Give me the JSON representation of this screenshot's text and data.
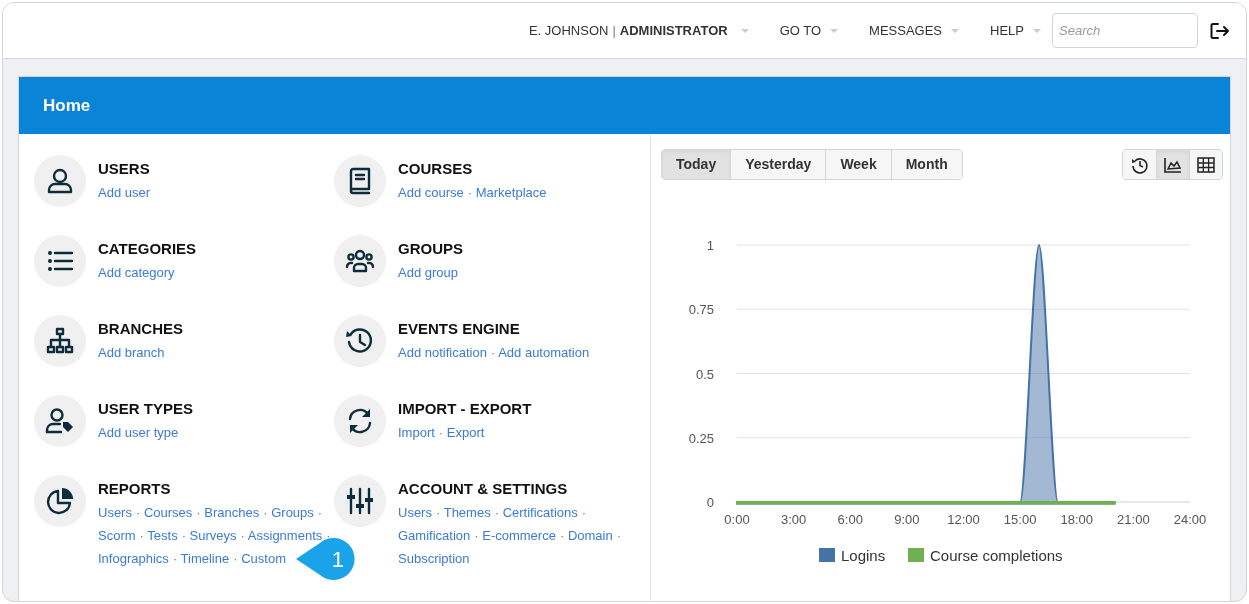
{
  "topbar": {
    "user": "E. JOHNSON",
    "user_separator": "|",
    "role": "ADMINISTRATOR",
    "menus": [
      {
        "label": "GO TO"
      },
      {
        "label": "MESSAGES"
      },
      {
        "label": "HELP"
      }
    ],
    "search": {
      "placeholder": "Search"
    }
  },
  "panel": {
    "title": "Home"
  },
  "separator": "·",
  "sections": [
    {
      "title": "USERS",
      "links": [
        "Add user"
      ]
    },
    {
      "title": "COURSES",
      "links": [
        "Add course",
        "Marketplace"
      ]
    },
    {
      "title": "CATEGORIES",
      "links": [
        "Add category"
      ]
    },
    {
      "title": "GROUPS",
      "links": [
        "Add group"
      ]
    },
    {
      "title": "BRANCHES",
      "links": [
        "Add branch"
      ]
    },
    {
      "title": "EVENTS ENGINE",
      "links": [
        "Add notification",
        "Add automation"
      ]
    },
    {
      "title": "USER TYPES",
      "links": [
        "Add user type"
      ]
    },
    {
      "title": "IMPORT - EXPORT",
      "links": [
        "Import",
        "Export"
      ]
    },
    {
      "title": "REPORTS",
      "links": [
        "Users",
        "Courses",
        "Branches",
        "Groups",
        "Scorm",
        "Tests",
        "Surveys",
        "Assignments",
        "Infographics",
        "Timeline",
        "Custom"
      ]
    },
    {
      "title": "ACCOUNT & SETTINGS",
      "links": [
        "Users",
        "Themes",
        "Certifications",
        "Gamification",
        "E-commerce",
        "Domain",
        "Subscription"
      ]
    }
  ],
  "callout": {
    "label": "1"
  },
  "periods": [
    {
      "label": "Today",
      "selected": true
    },
    {
      "label": "Yesterday",
      "selected": false
    },
    {
      "label": "Week",
      "selected": false
    },
    {
      "label": "Month",
      "selected": false
    }
  ],
  "views": [
    {
      "kind": "history",
      "selected": false
    },
    {
      "kind": "area",
      "selected": true
    },
    {
      "kind": "table",
      "selected": false
    }
  ],
  "chart_data": {
    "type": "area",
    "x": [
      0,
      1,
      2,
      3,
      4,
      5,
      6,
      7,
      8,
      9,
      10,
      11,
      12,
      13,
      14,
      15,
      16,
      17,
      18,
      19,
      20
    ],
    "xlim": [
      0,
      24
    ],
    "xticks": [
      {
        "value": 0,
        "label": "0:00"
      },
      {
        "value": 3,
        "label": "3:00"
      },
      {
        "value": 6,
        "label": "6:00"
      },
      {
        "value": 9,
        "label": "9:00"
      },
      {
        "value": 12,
        "label": "12:00"
      },
      {
        "value": 15,
        "label": "15:00"
      },
      {
        "value": 18,
        "label": "18:00"
      },
      {
        "value": 21,
        "label": "21:00"
      },
      {
        "value": 24,
        "label": "24:00"
      }
    ],
    "ylim": [
      0,
      1
    ],
    "grid": true,
    "legend": "bottom",
    "yticks": [
      0,
      0.25,
      0.5,
      0.75,
      1
    ],
    "series": [
      {
        "name": "Logins",
        "color": "#4572a7",
        "values": [
          0,
          0,
          0,
          0,
          0,
          0,
          0,
          0,
          0,
          0,
          0,
          0,
          0,
          0,
          0,
          0,
          1,
          0,
          0,
          0,
          0
        ]
      },
      {
        "name": "Course completions",
        "color": "#70b050",
        "values": [
          0,
          0,
          0,
          0,
          0,
          0,
          0,
          0,
          0,
          0,
          0,
          0,
          0,
          0,
          0,
          0,
          0,
          0,
          0,
          0,
          0
        ]
      }
    ]
  }
}
